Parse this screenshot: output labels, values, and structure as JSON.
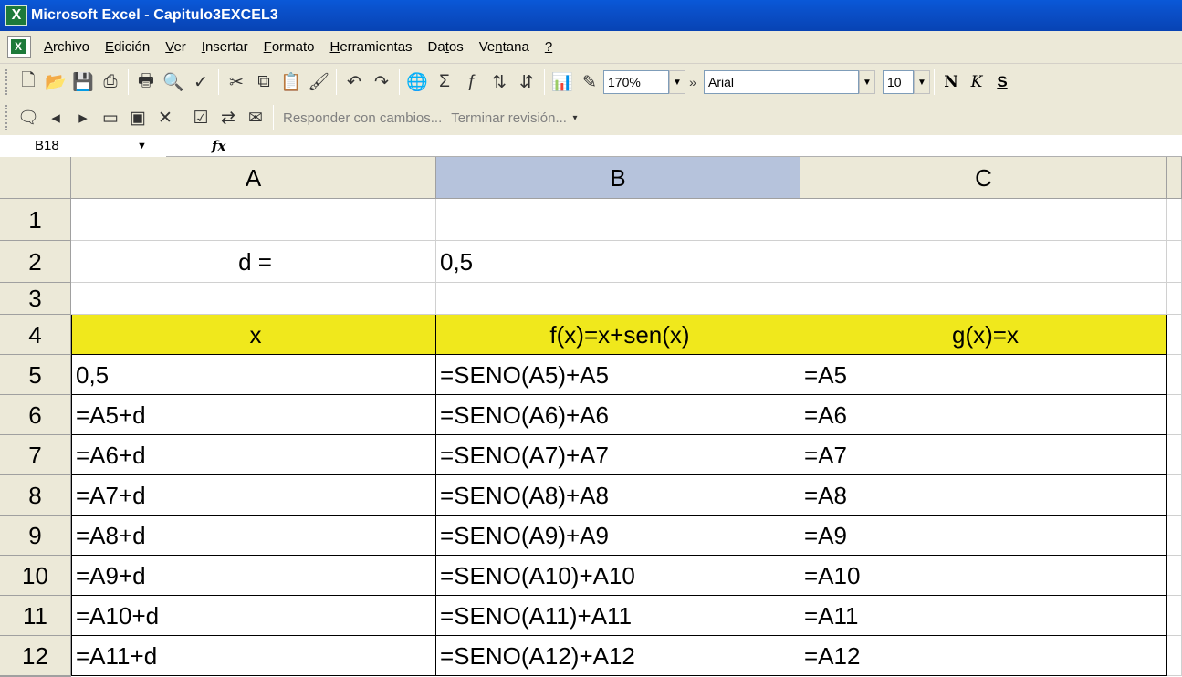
{
  "window": {
    "title": "Microsoft Excel - Capitulo3EXCEL3"
  },
  "menu": {
    "items": [
      {
        "pre": "",
        "u": "A",
        "post": "rchivo"
      },
      {
        "pre": "",
        "u": "E",
        "post": "dición"
      },
      {
        "pre": "",
        "u": "V",
        "post": "er"
      },
      {
        "pre": "",
        "u": "I",
        "post": "nsertar"
      },
      {
        "pre": "",
        "u": "F",
        "post": "ormato"
      },
      {
        "pre": "",
        "u": "H",
        "post": "erramientas"
      },
      {
        "pre": "Da",
        "u": "t",
        "post": "os"
      },
      {
        "pre": "Ve",
        "u": "n",
        "post": "tana"
      },
      {
        "pre": "",
        "u": "?",
        "post": ""
      }
    ]
  },
  "toolbar": {
    "zoom": "170%",
    "font": "Arial",
    "font_size": "10",
    "bold": "N",
    "italic": "K",
    "underline": "S"
  },
  "review_toolbar": {
    "reply": "Responder con cambios...",
    "end_review": "Terminar revisión..."
  },
  "formula_bar": {
    "name_box": "B18",
    "fx": "fx",
    "formula": ""
  },
  "sheet": {
    "columns": [
      "A",
      "B",
      "C"
    ],
    "selected_column": "B",
    "rows": [
      {
        "num": "1",
        "a": "",
        "b": "",
        "c": ""
      },
      {
        "num": "2",
        "a": "d      =",
        "b": "0,5",
        "c": ""
      },
      {
        "num": "3",
        "a": "",
        "b": "",
        "c": ""
      },
      {
        "num": "4",
        "a": "x",
        "b": "f(x)=x+sen(x)",
        "c": "g(x)=x"
      },
      {
        "num": "5",
        "a": "0,5",
        "b": "=SENO(A5)+A5",
        "c": "=A5"
      },
      {
        "num": "6",
        "a": "=A5+d",
        "b": "=SENO(A6)+A6",
        "c": "=A6"
      },
      {
        "num": "7",
        "a": "=A6+d",
        "b": "=SENO(A7)+A7",
        "c": "=A7"
      },
      {
        "num": "8",
        "a": "=A7+d",
        "b": "=SENO(A8)+A8",
        "c": "=A8"
      },
      {
        "num": "9",
        "a": "=A8+d",
        "b": "=SENO(A9)+A9",
        "c": "=A9"
      },
      {
        "num": "10",
        "a": "=A9+d",
        "b": "=SENO(A10)+A10",
        "c": "=A10"
      },
      {
        "num": "11",
        "a": "=A10+d",
        "b": "=SENO(A11)+A11",
        "c": "=A11"
      },
      {
        "num": "12",
        "a": "=A11+d",
        "b": "=SENO(A12)+A12",
        "c": "=A12"
      }
    ]
  },
  "colors": {
    "header_fill": "#f0e81c",
    "selected_column": "#b6c3dc",
    "chrome": "#ece9d8",
    "titlebar": "#0a4fc8"
  }
}
